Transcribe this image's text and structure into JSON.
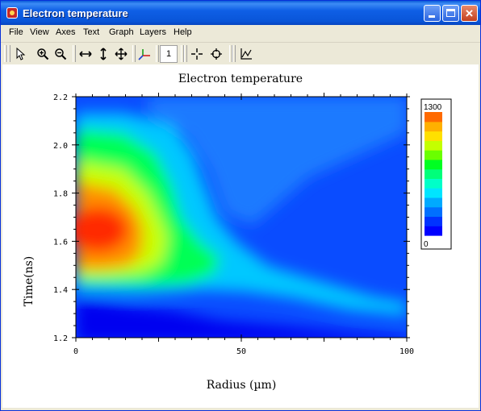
{
  "window": {
    "title": "Electron temperature",
    "controls": {
      "minimize": "minimize",
      "maximize": "maximize",
      "close": "×"
    }
  },
  "menu": [
    "File",
    "View",
    "Axes",
    "Text",
    "Graph",
    "Layers",
    "Help"
  ],
  "toolbar": {
    "tools": [
      "pointer-icon",
      "zoom-in-icon",
      "zoom-out-icon",
      "scale-horizontal-icon",
      "scale-vertical-icon",
      "move-icon",
      "axes-icon",
      "layer-number",
      "crosshair-icon",
      "data-reader-icon",
      "line-plot-icon"
    ],
    "layer_number": "1"
  },
  "colors": {
    "colormap": [
      "#0000ff",
      "#0033ff",
      "#0070ff",
      "#00aaff",
      "#00e5ff",
      "#00ffc8",
      "#00ff7a",
      "#00ff22",
      "#6aff00",
      "#c4ff00",
      "#ffe000",
      "#ffb000",
      "#ff6a00"
    ]
  },
  "chart_data": {
    "type": "heatmap",
    "title": "Electron temperature",
    "xlabel": "Radius (µm)",
    "ylabel": "Time(ns)",
    "xlim": [
      0,
      100
    ],
    "ylim": [
      1.2,
      2.2
    ],
    "x_ticks": [
      "0",
      "50",
      "100"
    ],
    "y_ticks": [
      "1.2",
      "1.4",
      "1.6",
      "1.8",
      "2.0",
      "2.2"
    ],
    "colorbar": {
      "max_label": "1300",
      "min_label": "0",
      "range": [
        0,
        1300
      ],
      "levels": 13
    },
    "hot_regions": [
      {
        "x": 8,
        "y": 1.58,
        "value": 1300
      },
      {
        "x": 28,
        "y": 1.52,
        "value": 900
      },
      {
        "x": 40,
        "y": 1.45,
        "value": 450
      },
      {
        "x": 70,
        "y": 1.38,
        "value": 250
      }
    ]
  }
}
